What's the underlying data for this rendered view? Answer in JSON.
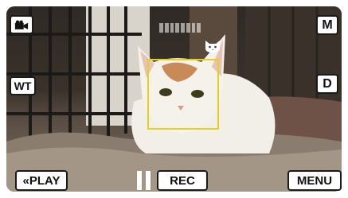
{
  "controls": {
    "wt_label": "WT",
    "m_label": "M",
    "d_label": "D",
    "play_label": "«PLAY",
    "rec_label": "REC",
    "menu_label": "MENU"
  },
  "icons": {
    "mode": "video-camera-icon",
    "pet": "cat-face-icon",
    "pause": "pause-icon"
  },
  "colors": {
    "face_box": "#e3d020",
    "button_bg": "#ffffff",
    "button_text": "#111111"
  }
}
